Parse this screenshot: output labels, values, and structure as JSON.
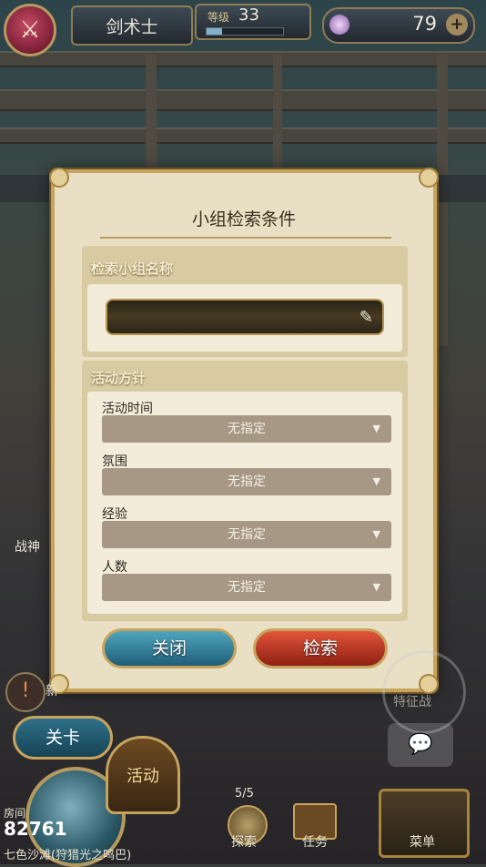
{
  "topbar": {
    "job_name": "剑术士",
    "level_label": "等级",
    "level": "33",
    "level_progress": 0.2,
    "gems": "79",
    "gem_plus": "+"
  },
  "dialog": {
    "title": "小组检索条件",
    "name_section": {
      "heading": "检索小组名称",
      "input_value": ""
    },
    "policy_section": {
      "heading": "活动方针",
      "fields": [
        {
          "label": "活动时间",
          "value": "无指定"
        },
        {
          "label": "氛围",
          "value": "无指定"
        },
        {
          "label": "经验",
          "value": "无指定"
        },
        {
          "label": "人数",
          "value": "无指定"
        }
      ]
    },
    "close_label": "关闭",
    "search_label": "检索"
  },
  "hud": {
    "stage_label": "关卡",
    "event_label": "活动",
    "room_label": "房间",
    "room_number": "82761",
    "location": "七色沙滩(狩猎光之鸣巴)",
    "explore_count": "5/5",
    "explore_label": "探索",
    "quest_label": "任务",
    "menu_label": "菜单",
    "left_label": "战神",
    "new_label": "新",
    "right_label": "特征战"
  }
}
